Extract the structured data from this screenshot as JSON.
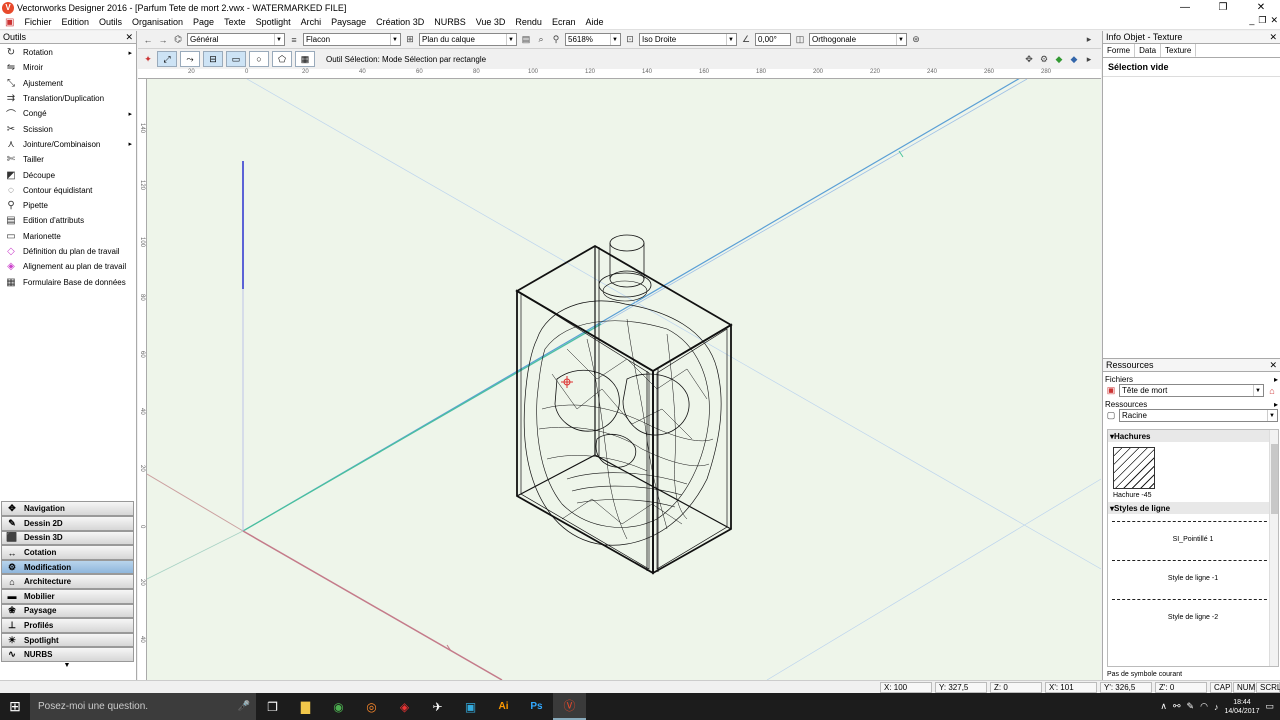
{
  "window": {
    "title": "Vectorworks Designer 2016 - [Parfum Tete de mort 2.vwx - WATERMARKED FILE]",
    "logo_letter": "V",
    "minimize": "—",
    "restore": "❐",
    "close": "✕"
  },
  "menubar": {
    "app_icon": "▣",
    "items": [
      "Fichier",
      "Edition",
      "Outils",
      "Organisation",
      "Page",
      "Texte",
      "Spotlight",
      "Archi",
      "Paysage",
      "Création 3D",
      "NURBS",
      "Vue 3D",
      "Rendu",
      "Ecran",
      "Aide"
    ],
    "mdi_min": "_",
    "mdi_restore": "❐",
    "mdi_close": "✕"
  },
  "tools_panel": {
    "title": "Outils",
    "close": "✕",
    "items": [
      {
        "label": "Rotation",
        "icon": "↻",
        "sub": true
      },
      {
        "label": "Miroir",
        "icon": "⇋",
        "sub": false
      },
      {
        "label": "Ajustement",
        "icon": "⤡",
        "sub": false
      },
      {
        "label": "Translation/Duplication",
        "icon": "⇉",
        "sub": false
      },
      {
        "label": "Congé",
        "icon": "⌒",
        "sub": true
      },
      {
        "label": "Scission",
        "icon": "✂",
        "sub": false
      },
      {
        "label": "Jointure/Combinaison",
        "icon": "⋏",
        "sub": true
      },
      {
        "label": "Tailler",
        "icon": "✄",
        "sub": false
      },
      {
        "label": "Découpe",
        "icon": "◩",
        "sub": false
      },
      {
        "label": "Contour équidistant",
        "icon": "◌",
        "sub": false
      },
      {
        "label": "Pipette",
        "icon": "⚲",
        "sub": false
      },
      {
        "label": "Edition d'attributs",
        "icon": "▤",
        "sub": false
      },
      {
        "label": "Marionette",
        "icon": "▭",
        "sub": false
      },
      {
        "label": "Définition du plan de travail",
        "icon": "◇",
        "sub": false
      },
      {
        "label": "Alignement au plan de travail",
        "icon": "◈",
        "sub": false
      },
      {
        "label": "Formulaire Base de données",
        "icon": "▦",
        "sub": false
      }
    ],
    "palettes": [
      {
        "label": "Navigation",
        "icon": "✥",
        "active": false
      },
      {
        "label": "Dessin 2D",
        "icon": "✎",
        "active": false
      },
      {
        "label": "Dessin 3D",
        "icon": "⬛",
        "active": false
      },
      {
        "label": "Cotation",
        "icon": "↔",
        "active": false
      },
      {
        "label": "Modification",
        "icon": "⚙",
        "active": true
      },
      {
        "label": "Architecture",
        "icon": "⌂",
        "active": false
      },
      {
        "label": "Mobilier",
        "icon": "▬",
        "active": false
      },
      {
        "label": "Paysage",
        "icon": "❀",
        "active": false
      },
      {
        "label": "Profilés",
        "icon": "⊥",
        "active": false
      },
      {
        "label": "Spotlight",
        "icon": "☀",
        "active": false
      },
      {
        "label": "NURBS",
        "icon": "∿",
        "active": false
      }
    ],
    "scroll_down": "▼",
    "submenu_arrow": "▸"
  },
  "toolbar1": {
    "back_icon": "←",
    "forward_icon": "→",
    "class_icon": "⌬",
    "class_value": "Général",
    "layer_icon": "≡",
    "layer_value": "Flacon",
    "plane_icon": "⊞",
    "plane_value": "Plan du calque",
    "page_icon": "▤",
    "zoom_icon": "⌕",
    "zoom_fit_icon": "⚲",
    "zoom_value": "5618%",
    "view_icon": "⊡",
    "view_value": "Iso Droite",
    "angle_icon": "∠",
    "angle_value": "0,00°",
    "render_icon": "◫",
    "render_value": "Orthogonale",
    "right_icon": "⊛",
    "more_icon": "▸"
  },
  "toolbar2": {
    "left_icon": "✦",
    "btn1": "⤢",
    "btn2": "⤳",
    "btn3": "⊟",
    "btn4": "▭",
    "btn5": "○",
    "btn6": "⬠",
    "btn7": "▦",
    "mode_text": "Outil Sélection: Mode Sélection par rectangle",
    "r1": "✥",
    "r2": "⚙",
    "r3": "◆",
    "r4": "◆",
    "more": "▸"
  },
  "ruler": {
    "h_ticks": [
      "20",
      "0",
      "20",
      "40",
      "60",
      "80",
      "100",
      "120",
      "140",
      "160",
      "180",
      "200",
      "220",
      "240",
      "260",
      "280"
    ],
    "v_ticks": [
      "140",
      "120",
      "100",
      "80",
      "60",
      "40",
      "20",
      "0",
      "20",
      "40"
    ]
  },
  "info_panel": {
    "title": "Info Objet - Texture",
    "close": "✕",
    "tabs": [
      "Forme",
      "Data",
      "Texture"
    ],
    "selection": "Sélection vide"
  },
  "resources_panel": {
    "title": "Ressources",
    "close": "✕",
    "files_label": "Fichiers",
    "files_value": "Tête de mort",
    "res_label": "Ressources",
    "res_value": "Racine",
    "hatch_group": "Hachures",
    "hatch_name": "Hachure -45",
    "line_group": "Styles de ligne",
    "line_styles": [
      "SI_Pointillé 1",
      "Style de ligne -1",
      "Style de ligne -2"
    ],
    "footer": "Pas de symbole courant",
    "toggle_icon": "▸",
    "group_open_icon": "▾",
    "home_icon": "⌂",
    "file_icon": "▣",
    "folder_icon": "▢"
  },
  "statusbar": {
    "x1": "X: 100",
    "y1": "Y: 327,5",
    "z1": "Z: 0",
    "x2": "X': 101",
    "y2": "Y': 326,5",
    "z2": "Z': 0",
    "cap": "CAP",
    "num": "NUM",
    "scrl": "SCRL"
  },
  "taskbar": {
    "start_icon": "⊞",
    "search_placeholder": "Posez-moi une question.",
    "mic_icon": "🎤",
    "apps": [
      "❐",
      "▇",
      "◉",
      "◎",
      "◈",
      "✈",
      "▣",
      "Ai",
      "Ps",
      "Ⓥ"
    ],
    "tray": {
      "chevron": "∧",
      "network": "⚯",
      "pen": "✎",
      "wifi": "◠",
      "volume": "♪",
      "time": "18:44",
      "date": "14/04/2017",
      "notify": "▭"
    }
  }
}
